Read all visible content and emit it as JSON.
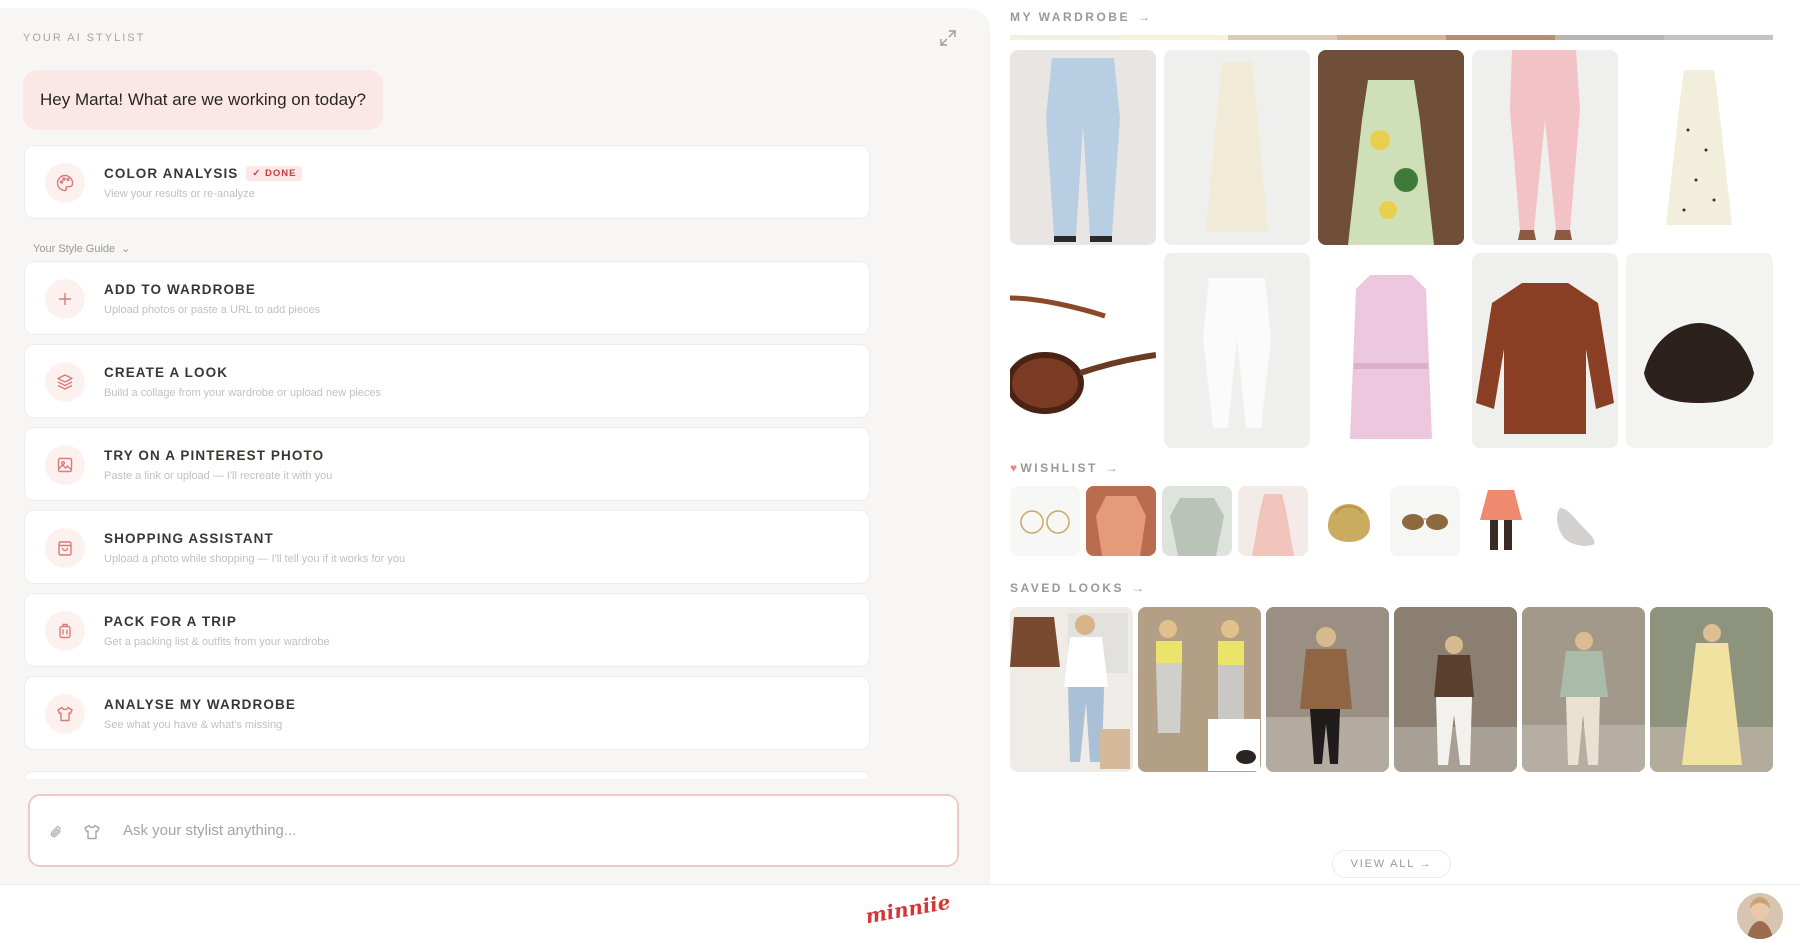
{
  "stylist": {
    "label": "YOUR AI STYLIST",
    "greeting": "Hey Marta! What are we working on today?",
    "color_analysis": {
      "title": "COLOR ANALYSIS",
      "badge": "DONE",
      "subtitle": "View your results or re-analyze"
    },
    "style_guide_label": "Your Style Guide",
    "actions": [
      {
        "title": "ADD TO WARDROBE",
        "subtitle": "Upload photos or paste a URL to add pieces",
        "icon": "plus-icon"
      },
      {
        "title": "CREATE A LOOK",
        "subtitle": "Build a collage from your wardrobe or upload new pieces",
        "icon": "layers-icon"
      },
      {
        "title": "TRY ON A PINTEREST PHOTO",
        "subtitle": "Paste a link or upload — I'll recreate it with you",
        "icon": "image-icon"
      },
      {
        "title": "SHOPPING ASSISTANT",
        "subtitle": "Upload a photo while shopping — I'll tell you if it works for you",
        "icon": "shopping-bag-icon"
      },
      {
        "title": "PACK FOR A TRIP",
        "subtitle": "Get a packing list & outfits from your wardrobe",
        "icon": "luggage-icon"
      },
      {
        "title": "ANALYSE MY WARDROBE",
        "subtitle": "See what you have & what's missing",
        "icon": "shirt-icon"
      }
    ],
    "input_placeholder": "Ask your stylist anything..."
  },
  "wardrobe": {
    "title": "MY WARDROBE",
    "arrow": "→",
    "palette": [
      "#f3efe1",
      "#f7f1dd",
      "#d9cdb8",
      "#d2b394",
      "#b58e6a",
      "#b9b5b0",
      "#c6c3c1"
    ],
    "items": [
      {
        "name": "light-wash jeans",
        "icon": "jeans-icon"
      },
      {
        "name": "ivory slip dress",
        "icon": "dress-icon"
      },
      {
        "name": "floral maxi dress",
        "icon": "dress-icon"
      },
      {
        "name": "pink trousers",
        "icon": "trousers-icon"
      },
      {
        "name": "polka dot dress",
        "icon": "dress-icon"
      },
      {
        "name": "tortoise sunglasses",
        "icon": "sunglasses-icon"
      },
      {
        "name": "white jeans",
        "icon": "jeans-icon"
      },
      {
        "name": "pink trench coat",
        "icon": "coat-icon"
      },
      {
        "name": "brown leather jacket",
        "icon": "jacket-icon"
      },
      {
        "name": "woven clutch",
        "icon": "bag-icon"
      }
    ]
  },
  "wishlist": {
    "title": "WISHLIST",
    "arrow": "→",
    "icon": "heart-icon",
    "items": [
      {
        "name": "gold glasses",
        "icon": "glasses-icon"
      },
      {
        "name": "coral blouse",
        "icon": "blouse-icon"
      },
      {
        "name": "gingham top",
        "icon": "top-icon"
      },
      {
        "name": "pink dress",
        "icon": "dress-icon"
      },
      {
        "name": "woven bag",
        "icon": "bag-icon"
      },
      {
        "name": "aviator sunglasses",
        "icon": "sunglasses-icon"
      },
      {
        "name": "coral skirt",
        "icon": "skirt-icon"
      },
      {
        "name": "sneaker",
        "icon": "sneaker-icon"
      }
    ]
  },
  "saved_looks": {
    "title": "SAVED LOOKS",
    "arrow": "→",
    "view_all": "VIEW ALL →",
    "looks": [
      {
        "name": "look-1"
      },
      {
        "name": "look-2"
      },
      {
        "name": "look-3"
      },
      {
        "name": "look-4"
      },
      {
        "name": "look-5"
      },
      {
        "name": "look-6"
      }
    ]
  },
  "footer": {
    "logo": "minniie"
  },
  "colors": {
    "accent": "#d63535",
    "soft_pink": "#fbe7e5",
    "icon_pink": "#d97b79"
  }
}
